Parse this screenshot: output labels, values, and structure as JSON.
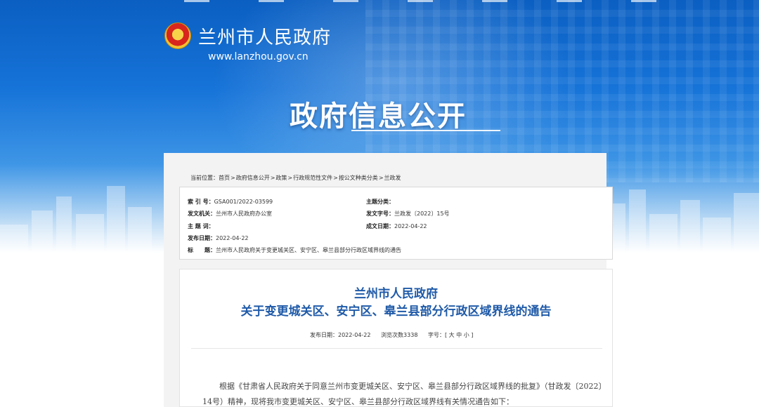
{
  "header": {
    "site_name": "兰州市人民政府",
    "site_url": "www.lanzhou.gov.cn",
    "banner_title": "政府信息公开",
    "emblem_icon": "national-emblem-icon"
  },
  "breadcrumb": {
    "label": "当前位置：",
    "items": [
      "首页",
      "政府信息公开",
      "政策",
      "行政规范性文件",
      "按公文种类分类",
      "兰政发"
    ]
  },
  "meta": {
    "index_label": "索 引 号：",
    "index_value": "GSA001/2022-03599",
    "topic_label": "主题分类：",
    "topic_value": "",
    "issuer_label": "发文机关：",
    "issuer_value": "兰州市人民政府办公室",
    "docno_label": "发文字号：",
    "docno_value": "兰政发〔2022〕15号",
    "keyword_label": "主 题 词：",
    "keyword_value": "",
    "created_label": "成文日期：",
    "created_value": "2022-04-22",
    "published_label": "发布日期：",
    "published_value": "2022-04-22",
    "title_label": "标　　题：",
    "title_value": "兰州市人民政府关于变更城关区、安宁区、皋兰县部分行政区域界线的通告"
  },
  "article": {
    "title_line1": "兰州市人民政府",
    "title_line2": "关于变更城关区、安宁区、皋兰县部分行政区域界线的通告",
    "publish_date": "发布日期：2022-04-22",
    "views": "浏览次数3338",
    "font_size": "字号：[ 大 中 小 ]",
    "paragraph": "根据《甘肃省人民政府关于同意兰州市变更城关区、安宁区、皋兰县部分行政区域界线的批复》（甘政发〔2022〕14号）精神，现将我市变更城关区、安宁区、皋兰县部分行政区域界线有关情况通告如下："
  },
  "colors": {
    "banner_blue": "#1673d8",
    "title_blue": "#1f5aa8",
    "panel_bg": "#f3f3f3"
  }
}
